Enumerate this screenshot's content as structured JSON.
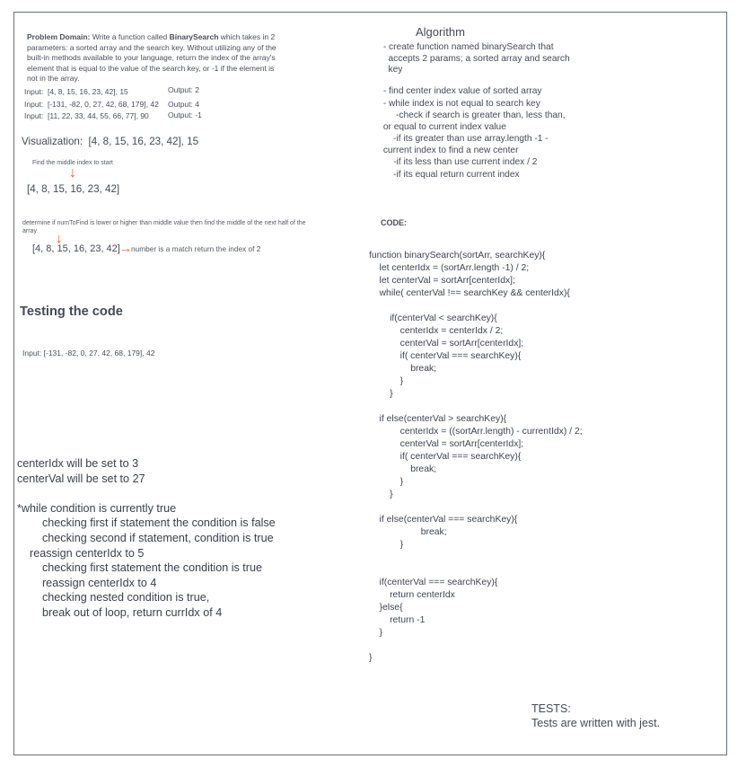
{
  "problem": {
    "heading": "Problem Domain:",
    "text_1": " Write a function called ",
    "bold": "BinarySearch",
    "text_2": " which takes in 2",
    "lines": [
      "parameters: a sorted array and the search key. Without utilizing any of the",
      "built-in methods available to your language, return the index of the array's",
      "element that is equal to the value of the search key, or -1 if the element is",
      "not in the array."
    ]
  },
  "examples": [
    {
      "input": "Input:  [4, 8, 15, 16, 23, 42], 15",
      "output": "Output: 2"
    },
    {
      "input": "Input:  [-131, -82, 0, 27, 42, 68, 179], 42",
      "output": "Output: 4"
    },
    {
      "input": "Input:  [11, 22, 33, 44, 55, 66, 77], 90",
      "output": "Output: -1"
    }
  ],
  "visualization": {
    "label": "Visualization:  [4, 8, 15, 16, 23, 42], 15",
    "note_1": "Find the middle index to start",
    "array_1": "[4, 8, 15, 16, 23, 42]",
    "note_2_line_1": "determine if numToFind is lower or higher than middle value then find the middle of the next half of the",
    "note_2_line_2": "array",
    "array_2": "[4, 8, 15, 16, 23, 42]",
    "match_text": "number is a match return the index of 2",
    "arrow_down": "↓",
    "arrow_right": "→"
  },
  "testing": {
    "heading": "Testing the code",
    "input": "Input: [-131, -82, 0, 27, 42, 68, 179], 42"
  },
  "walkthrough": [
    "centerIdx will be set to 3",
    "centerVal will be set to 27",
    "",
    "*while condition is currently true",
    "        checking first if statement the condition is false",
    "        checking second if statement, condition is true",
    "    reassign centerIdx to 5",
    "        checking first statement the condition is true",
    "        reassign centerIdx to 4",
    "        checking nested condition is true,",
    "        break out of loop, return currIdx of 4"
  ],
  "algorithm": {
    "title": "Algorithm",
    "steps": [
      " - create function named binarySearch that",
      "   accepts 2 params; a sorted array and search",
      "   key",
      "",
      " - find center index value of sorted array",
      " - while index is not equal to search key",
      "      -check if search is greater than, less than,",
      " or equal to current index value",
      "     -if its greater than use array.length -1 -",
      " current index to find a new center",
      "     -if its less than use current index / 2",
      "     -if its equal return current index"
    ]
  },
  "code": {
    "label": "CODE:",
    "lines": [
      "function binarySearch(sortArr, searchKey){",
      "    let centerIdx = (sortArr.length -1) / 2;",
      "    let centerVal = sortArr[centerIdx];",
      "    while( centerVal !== searchKey && centerIdx){",
      "",
      "        if(centerVal < searchKey){",
      "            centerIdx = centerIdx / 2;",
      "            centerVal = sortArr[centerIdx];",
      "            if( centerVal === searchKey){",
      "                break;",
      "            }",
      "        }",
      "",
      "    if else(centerVal > searchKey){",
      "            centerIdx = ((sortArr.length) - currentIdx) / 2;",
      "            centerVal = sortArr[centerIdx];",
      "            if( centerVal === searchKey){",
      "                break;",
      "            }",
      "        }",
      "",
      "    if else(centerVal === searchKey){",
      "                    break;",
      "            }",
      "",
      "",
      "    if(centerVal === searchKey){",
      "        return centerIdx",
      "    }else{",
      "        return -1",
      "    }",
      "",
      "}"
    ]
  },
  "tests": {
    "label": "TESTS:",
    "text": "Tests are written with jest."
  }
}
